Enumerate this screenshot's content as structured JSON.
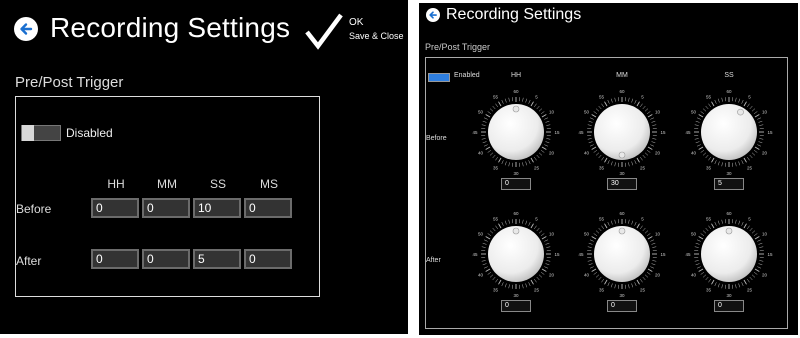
{
  "left": {
    "title": "Recording Settings",
    "ok_label": "OK",
    "ok_sublabel": "Save & Close",
    "section_title": "Pre/Post Trigger",
    "toggle_label": "Disabled",
    "toggle_state": "off",
    "columns": [
      "HH",
      "MM",
      "SS",
      "MS"
    ],
    "rows": [
      {
        "label": "Before",
        "values": [
          "0",
          "0",
          "10",
          "0"
        ]
      },
      {
        "label": "After",
        "values": [
          "0",
          "0",
          "5",
          "0"
        ]
      }
    ]
  },
  "right": {
    "title": "Recording Settings",
    "section_title": "Pre/Post Trigger",
    "toggle_label": "Enabled",
    "toggle_state": "on",
    "columns": [
      "HH",
      "MM",
      "SS"
    ],
    "dial_scale": [
      "60",
      "5",
      "10",
      "15",
      "20",
      "25",
      "30",
      "35",
      "40",
      "45",
      "50",
      "55"
    ],
    "rows": [
      {
        "label": "Before",
        "values": [
          "0",
          "30",
          "5"
        ]
      },
      {
        "label": "After",
        "values": [
          "0",
          "0",
          "0"
        ]
      }
    ]
  },
  "colors": {
    "panel_bg": "#000000",
    "accent_blue": "#2f7fe0",
    "field_bg": "#333333",
    "field_border": "#6b6b6b"
  },
  "icons": {
    "back": "back-arrow-icon",
    "ok": "checkmark-icon"
  }
}
